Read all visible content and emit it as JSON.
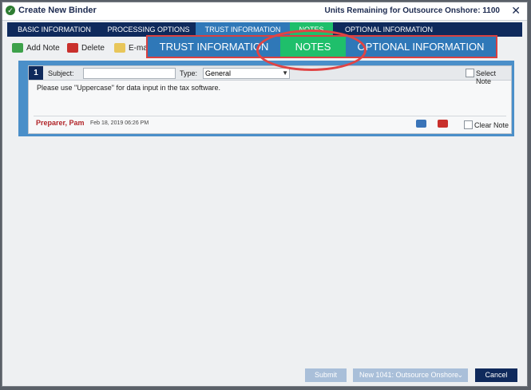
{
  "window": {
    "title": "Create New Binder",
    "units_remaining": "Units Remaining for Outsource Onshore: 1100",
    "close_symbol": "✕"
  },
  "tabs": [
    {
      "label": "BASIC INFORMATION"
    },
    {
      "label": "PROCESSING OPTIONS"
    },
    {
      "label": "TRUST INFORMATION"
    },
    {
      "label": "NOTES"
    },
    {
      "label": "OPTIONAL INFORMATION"
    }
  ],
  "toolbar": {
    "add_note": "Add Note",
    "delete": "Delete",
    "email": "E-mai"
  },
  "zoom": {
    "trust": "TRUST INFORMATION",
    "notes": "NOTES",
    "optional": "OPTIONAL INFORMATION"
  },
  "note": {
    "number": "1",
    "subject_label": "Subject:",
    "subject_value": "",
    "type_label": "Type:",
    "type_value": "General",
    "select_note_label": "Select Note",
    "body": "Please use \"Uppercase\" for data input in the tax software.",
    "preparer": "Preparer, Pam",
    "date": "Feb 18, 2019 06:26 PM",
    "clear_note_label": "Clear Note"
  },
  "footer": {
    "submit": "Submit",
    "new_type": "New 1041: Outsource Onshore",
    "cancel": "Cancel"
  },
  "colors": {
    "navy": "#0f2a5c",
    "active_blue": "#2f78b8",
    "notes_green": "#1fbf6b",
    "highlight_red": "#e04444"
  }
}
